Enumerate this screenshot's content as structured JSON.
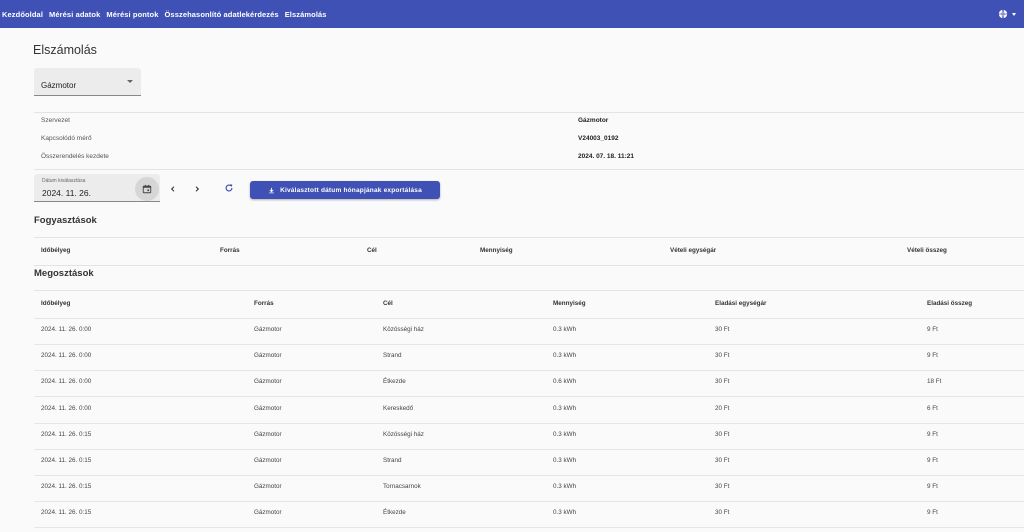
{
  "nav": {
    "items": [
      "Kezdőoldal",
      "Mérési adatok",
      "Mérési pontok",
      "Összehasonlító adatlekérdezés",
      "Elszámolás"
    ],
    "language_icon": "globe-icon"
  },
  "page": {
    "title": "Elszámolás"
  },
  "meter_select": {
    "value": "Gázmotor"
  },
  "info": [
    {
      "label": "Szervezet",
      "value": "Gázmotor"
    },
    {
      "label": "Kapcsolódó mérő",
      "value": "V24003_0192"
    },
    {
      "label": "Összerendelés kezdete",
      "value": "2024. 07. 18. 11:21"
    }
  ],
  "date_picker": {
    "label": "Dátum kiválasztása",
    "value": "2024. 11. 26."
  },
  "export_button": {
    "label": "Kiválasztott dátum hónapjának exportálása"
  },
  "consumption": {
    "title": "Fogyasztások",
    "headers": [
      "Időbélyeg",
      "Forrás",
      "Cél",
      "Mennyiség",
      "Vételi egységár",
      "Vételi összeg"
    ]
  },
  "sharing": {
    "title": "Megosztások",
    "headers": [
      "Időbélyeg",
      "Forrás",
      "Cél",
      "Mennyiség",
      "Eladási egységár",
      "Eladási összeg"
    ],
    "rows": [
      [
        "2024. 11. 26. 0:00",
        "Gázmotor",
        "Közösségi ház",
        "0.3 kWh",
        "30 Ft",
        "9 Ft"
      ],
      [
        "2024. 11. 26. 0:00",
        "Gázmotor",
        "Strand",
        "0.3 kWh",
        "30 Ft",
        "9 Ft"
      ],
      [
        "2024. 11. 26. 0:00",
        "Gázmotor",
        "Étkezde",
        "0.6 kWh",
        "30 Ft",
        "18 Ft"
      ],
      [
        "2024. 11. 26. 0:00",
        "Gázmotor",
        "Kereskedő",
        "0.3 kWh",
        "20 Ft",
        "6 Ft"
      ],
      [
        "2024. 11. 26. 0:15",
        "Gázmotor",
        "Közösségi ház",
        "0.3 kWh",
        "30 Ft",
        "9 Ft"
      ],
      [
        "2024. 11. 26. 0:15",
        "Gázmotor",
        "Strand",
        "0.3 kWh",
        "30 Ft",
        "9 Ft"
      ],
      [
        "2024. 11. 26. 0:15",
        "Gázmotor",
        "Tornacsarnok",
        "0.3 kWh",
        "30 Ft",
        "9 Ft"
      ],
      [
        "2024. 11. 26. 0:15",
        "Gázmotor",
        "Étkezde",
        "0.3 kWh",
        "30 Ft",
        "9 Ft"
      ]
    ]
  },
  "colors": {
    "primary": "#3f51b5",
    "background": "#fafafa"
  }
}
